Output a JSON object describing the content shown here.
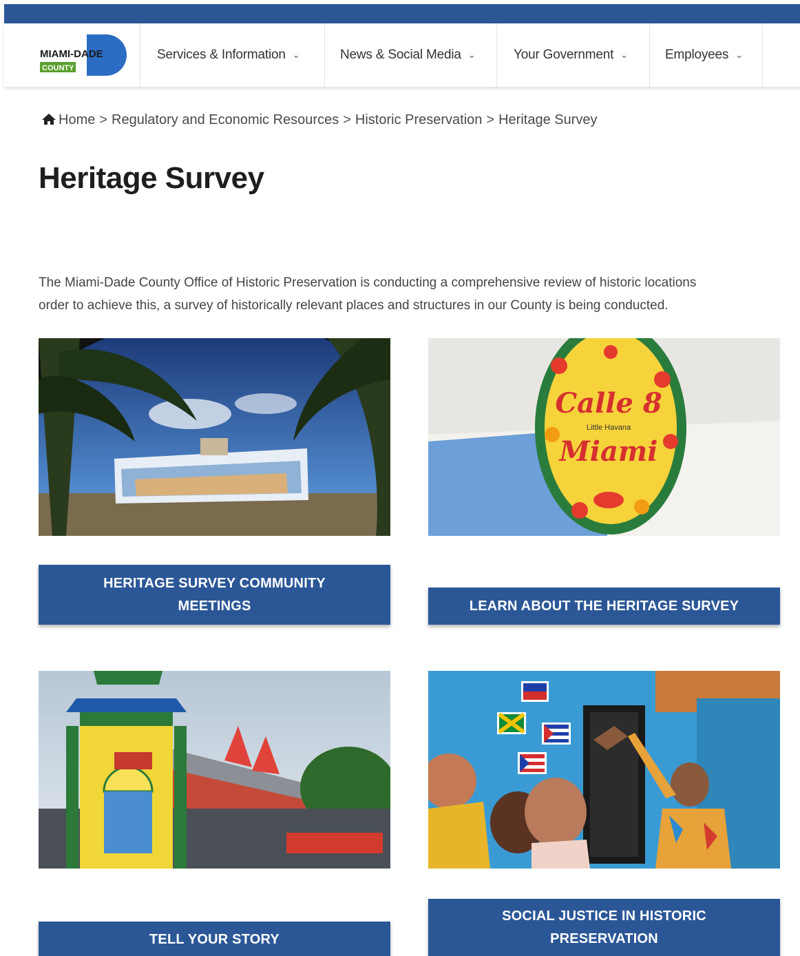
{
  "header": {
    "logo_text_top": "MIAMI-DADE",
    "logo_text_bottom": "COUNTY",
    "nav": [
      {
        "label": "Services & Information"
      },
      {
        "label": "News & Social Media"
      },
      {
        "label": "Your Government"
      },
      {
        "label": "Employees"
      }
    ]
  },
  "breadcrumb": {
    "items": [
      "Home",
      "Regulatory and Economic Resources",
      "Historic Preservation",
      "Heritage Survey"
    ],
    "separator": ">"
  },
  "page": {
    "title": "Heritage Survey",
    "intro_line1": "The Miami-Dade County Office of Historic Preservation is conducting a comprehensive review of historic locations",
    "intro_line2": "order to achieve this, a survey of historically relevant places and structures in our County is being conducted."
  },
  "cards": [
    {
      "button": "HERITAGE SURVEY COMMUNITY MEETINGS",
      "image": "mural-wall-photo"
    },
    {
      "button": "LEARN ABOUT THE HERITAGE SURVEY",
      "image": "calle-8-tile-sign-photo",
      "sign_line1": "Calle 8",
      "sign_line2": "Little Havana",
      "sign_line3": "Miami"
    },
    {
      "button": "TELL YOUR STORY",
      "image": "colorful-market-building-photo"
    },
    {
      "button": "SOCIAL JUSTICE IN HISTORIC PRESERVATION",
      "image": "flags-mural-photo"
    }
  ],
  "colors": {
    "brand_blue": "#2b5797",
    "logo_green": "#5aa02c"
  }
}
